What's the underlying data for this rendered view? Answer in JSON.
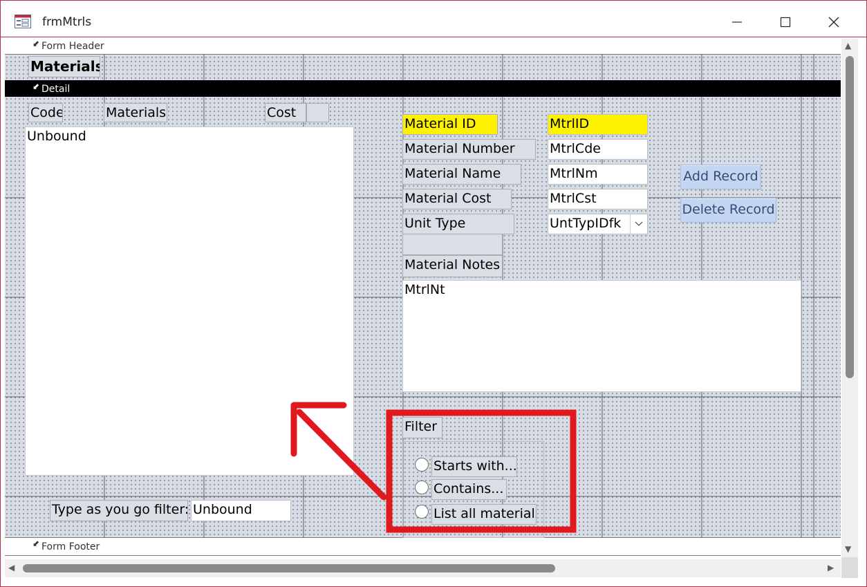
{
  "window": {
    "title": "frmMtrls"
  },
  "sections": {
    "header": "Form Header",
    "detail": "Detail",
    "footer": "Form Footer"
  },
  "header": {
    "title": "Materials"
  },
  "list": {
    "col_code": "Code",
    "col_materials": "Materials",
    "col_cost": "Cost",
    "listbox_value": "Unbound"
  },
  "fields": {
    "material_id": {
      "label": "Material ID",
      "value": "MtrlID"
    },
    "material_number": {
      "label": "Material Number",
      "value": "MtrlCde"
    },
    "material_name": {
      "label": "Material Name",
      "value": "MtrlNm"
    },
    "material_cost": {
      "label": "Material Cost",
      "value": "MtrlCst"
    },
    "unit_type": {
      "label": "Unit Type",
      "value": "UntTypIDfk"
    },
    "material_notes": {
      "label": "Material Notes",
      "value": "MtrlNt"
    }
  },
  "buttons": {
    "add": "Add Record",
    "delete": "Delete Record"
  },
  "filter": {
    "title": "Filter",
    "options": [
      "Starts with...",
      "Contains...",
      "List all materials"
    ]
  },
  "type_filter": {
    "label": "Type as you go filter:",
    "value": "Unbound"
  },
  "colors": {
    "highlight": "#fff200",
    "annotation": "#e0191f",
    "window_border": "#b5304a"
  }
}
